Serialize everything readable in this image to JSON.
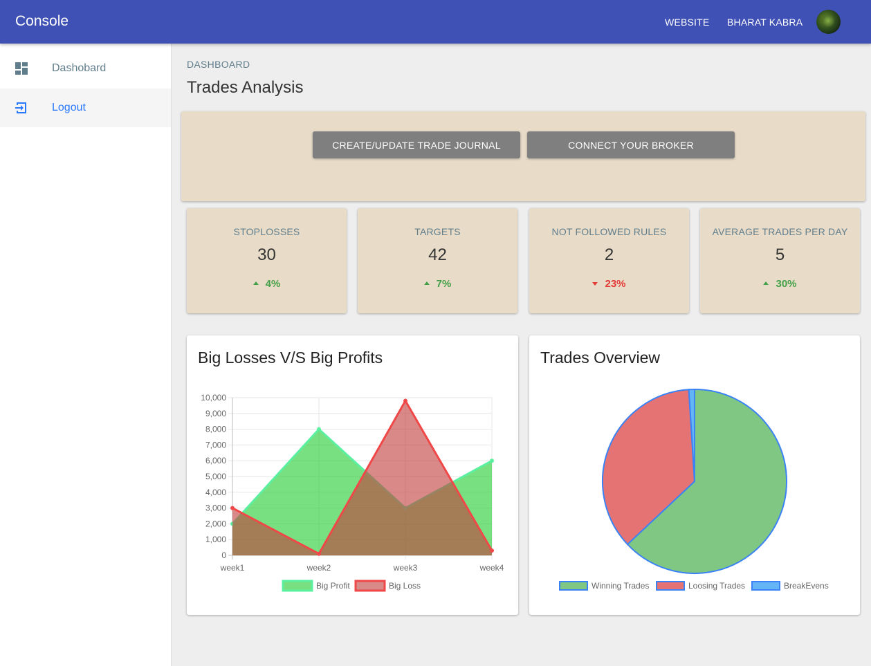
{
  "app": {
    "brand": "Console"
  },
  "topbar": {
    "website_label": "WEBSITE",
    "user_name": "BHARAT KABRA"
  },
  "sidebar": {
    "items": [
      {
        "label": "Dashobard",
        "icon": "dashboard-icon",
        "color": "#607d8b",
        "active": false
      },
      {
        "label": "Logout",
        "icon": "logout-icon",
        "color": "#2979ff",
        "active": true
      }
    ]
  },
  "page": {
    "breadcrumb": "DASHBOARD",
    "title": "Trades Analysis"
  },
  "actions": {
    "journal_label": "CREATE/UPDATE TRADE JOURNAL",
    "broker_label": "CONNECT YOUR BROKER"
  },
  "stats": [
    {
      "label": "STOPLOSSES",
      "value": "30",
      "change": "4%",
      "direction": "up",
      "color": "#43a047"
    },
    {
      "label": "TARGETS",
      "value": "42",
      "change": "7%",
      "direction": "up",
      "color": "#43a047"
    },
    {
      "label": "NOT FOLLOWED RULES",
      "value": "2",
      "change": "23%",
      "direction": "down",
      "color": "#e53935"
    },
    {
      "label": "AVERAGE TRADES PER DAY",
      "value": "5",
      "change": "30%",
      "direction": "up",
      "color": "#43a047"
    }
  ],
  "chart_data": [
    {
      "type": "area",
      "title": "Big Losses V/S Big Profits",
      "categories": [
        "week1",
        "week2",
        "week3",
        "week4"
      ],
      "series": [
        {
          "name": "Big Profit",
          "values": [
            2000,
            8000,
            3000,
            6000
          ],
          "color": "#1fcc2e",
          "border": "#5af0a0"
        },
        {
          "name": "Big Loss",
          "values": [
            3000,
            100,
            9800,
            300
          ],
          "color": "#c23b3b",
          "border": "#f04848"
        }
      ],
      "ylim": [
        0,
        10000
      ],
      "yticks": [
        "0",
        "1,000",
        "2,000",
        "3,000",
        "4,000",
        "5,000",
        "6,000",
        "7,000",
        "8,000",
        "9,000",
        "10,000"
      ],
      "grid": true,
      "legend": "bottom"
    },
    {
      "type": "pie",
      "title": "Trades Overview",
      "series": [
        {
          "name": "Winning Trades",
          "value": 63,
          "color": "#81c784"
        },
        {
          "name": "Loosing Trades",
          "value": 36,
          "color": "#e57373"
        },
        {
          "name": "BreakEvens",
          "value": 1,
          "color": "#64b5f6"
        }
      ],
      "border_color": "#3b82f6",
      "legend": "bottom"
    }
  ]
}
